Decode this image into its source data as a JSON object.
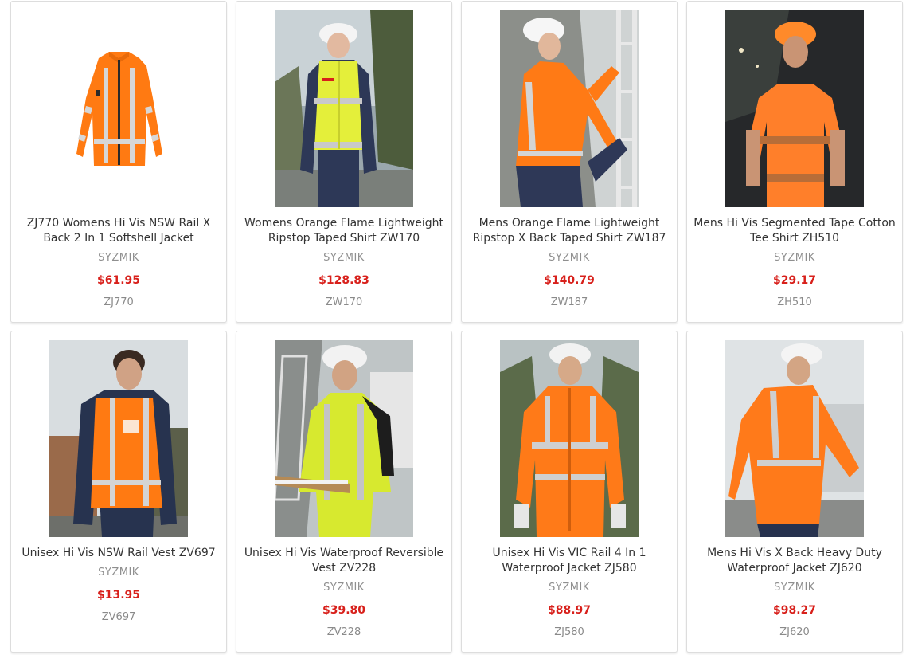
{
  "products": [
    {
      "title": "ZJ770 Womens Hi Vis NSW Rail X Back 2 In 1 Softshell Jacket",
      "brand": "SYZMIK",
      "price": "$61.95",
      "sku": "ZJ770",
      "image": "orange-softshell-jacket"
    },
    {
      "title": "Womens Orange Flame Lightweight Ripstop Taped Shirt ZW170",
      "brand": "SYZMIK",
      "price": "$128.83",
      "sku": "ZW170",
      "image": "woman-yellow-navy-shirt"
    },
    {
      "title": "Mens Orange Flame Lightweight Ripstop X Back Taped Shirt ZW187",
      "brand": "SYZMIK",
      "price": "$140.79",
      "sku": "ZW187",
      "image": "man-orange-shirt-ladder"
    },
    {
      "title": "Mens Hi Vis Segmented Tape Cotton Tee Shirt ZH510",
      "brand": "SYZMIK",
      "price": "$29.17",
      "sku": "ZH510",
      "image": "man-orange-tee"
    },
    {
      "title": "Unisex Hi Vis NSW Rail Vest ZV697",
      "brand": "SYZMIK",
      "price": "$13.95",
      "sku": "ZV697",
      "image": "man-orange-vest"
    },
    {
      "title": "Unisex Hi Vis Waterproof Reversible Vest ZV228",
      "brand": "SYZMIK",
      "price": "$39.80",
      "sku": "ZV228",
      "image": "man-yellow-vest-clipboard"
    },
    {
      "title": "Unisex Hi Vis VIC Rail 4 In 1 Waterproof Jacket ZJ580",
      "brand": "SYZMIK",
      "price": "$88.97",
      "sku": "ZJ580",
      "image": "man-orange-rain-jacket"
    },
    {
      "title": "Mens Hi Vis X Back Heavy Duty Waterproof Jacket ZJ620",
      "brand": "SYZMIK",
      "price": "$98.27",
      "sku": "ZJ620",
      "image": "man-orange-heavy-jacket"
    }
  ],
  "colors": {
    "price": "#d8201b",
    "hivis_orange": "#ff7a1a",
    "hivis_yellow": "#e6f02e",
    "navy": "#2b3550",
    "tape": "#c9c9c9"
  }
}
